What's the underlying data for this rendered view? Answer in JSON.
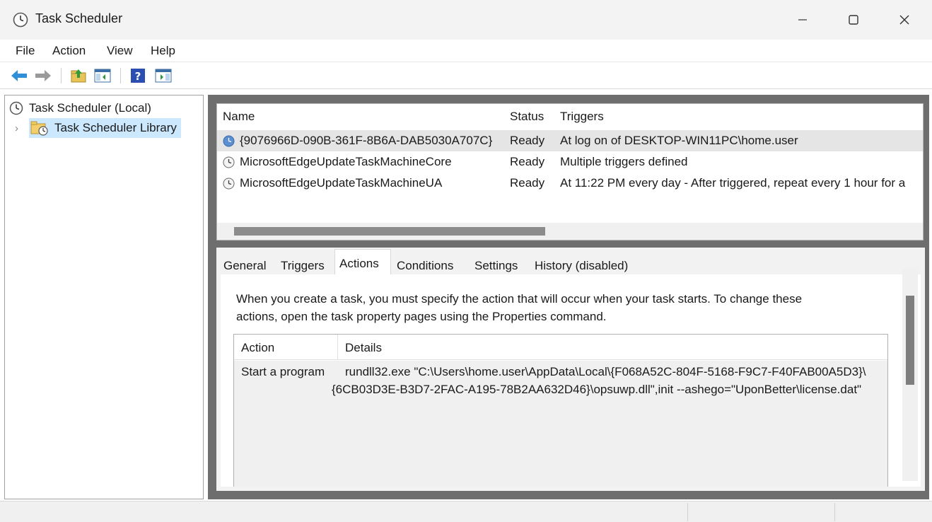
{
  "window": {
    "title": "Task Scheduler"
  },
  "menu": {
    "items": [
      "File",
      "Action",
      "View",
      "Help"
    ]
  },
  "toolbar": {
    "icons": [
      "back-arrow-icon",
      "forward-arrow-icon",
      "folder-up-icon",
      "show-hide-console-tree-icon",
      "help-icon",
      "show-hide-action-pane-icon"
    ]
  },
  "tree": {
    "root": "Task Scheduler (Local)",
    "child": "Task Scheduler Library"
  },
  "task_list": {
    "columns": [
      "Name",
      "Status",
      "Triggers"
    ],
    "rows": [
      {
        "name": "{9076966D-090B-361F-8B6A-DAB5030A707C}",
        "status": "Ready",
        "triggers": "At log on of DESKTOP-WIN11PC\\home.user"
      },
      {
        "name": "MicrosoftEdgeUpdateTaskMachineCore",
        "status": "Ready",
        "triggers": "Multiple triggers defined"
      },
      {
        "name": "MicrosoftEdgeUpdateTaskMachineUA",
        "status": "Ready",
        "triggers": "At 11:22 PM every day - After triggered, repeat every 1 hour for a"
      }
    ],
    "selected_row": 0
  },
  "detail": {
    "tabs": [
      "General",
      "Triggers",
      "Actions",
      "Conditions",
      "Settings",
      "History (disabled)"
    ],
    "active_tab": "Actions",
    "info_line1": "When you create a task, you must specify the action that will occur when your task starts.  To change these",
    "info_line2": "actions, open the task property pages using the Properties command.",
    "actions_table": {
      "columns": [
        "Action",
        "Details"
      ],
      "rows": [
        {
          "action": "Start a program",
          "details_line1": "rundll32.exe \"C:\\Users\\home.user\\AppData\\Local\\{F068A52C-804F-5168-F9C7-F40FAB00A5D3}\\",
          "details_line2": "{6CB03D3E-B3D7-2FAC-A195-78B2AA632D46}\\opsuwp.dll\",init --ashego=\"UponBetter\\license.dat\""
        }
      ]
    }
  },
  "colors": {
    "selection": "#cce8ff",
    "row_selected": "#e5e5e5",
    "frame": "#6e6e6e"
  }
}
